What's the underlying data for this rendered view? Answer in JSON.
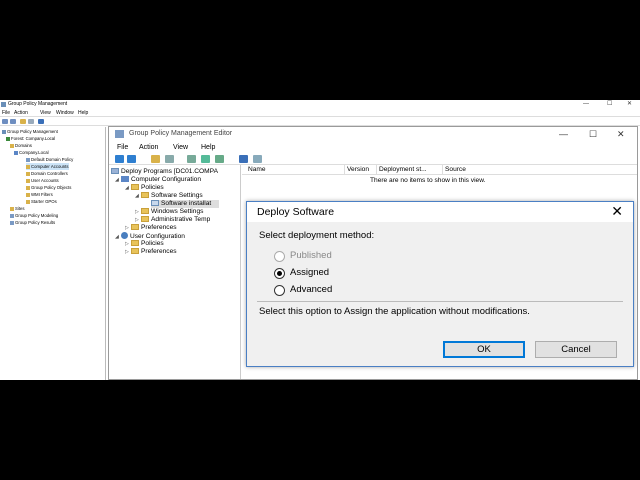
{
  "outer": {
    "title": "Group Policy Management",
    "menu": [
      "File",
      "Action",
      "View",
      "Window",
      "Help"
    ],
    "tree": [
      {
        "label": "Group Policy Management",
        "indent": 0
      },
      {
        "label": "Forest: Company.Local",
        "indent": 1
      },
      {
        "label": "Domains",
        "indent": 2
      },
      {
        "label": "Company.Local",
        "indent": 3
      },
      {
        "label": "Default Domain Policy",
        "indent": 4
      },
      {
        "label": "Computer Accounts",
        "indent": 4
      },
      {
        "label": "Domain Controllers",
        "indent": 4
      },
      {
        "label": "User Accounts",
        "indent": 4
      },
      {
        "label": "Group Policy Objects",
        "indent": 4
      },
      {
        "label": "WMI Filters",
        "indent": 4
      },
      {
        "label": "Starter GPOs",
        "indent": 4
      },
      {
        "label": "Sites",
        "indent": 2
      },
      {
        "label": "Group Policy Modeling",
        "indent": 2
      },
      {
        "label": "Group Policy Results",
        "indent": 2
      }
    ]
  },
  "inner": {
    "title": "Group Policy Management Editor",
    "menu": [
      "File",
      "Action",
      "View",
      "Help"
    ],
    "tree": [
      {
        "label": "Deploy Programs [DC01.COMPA",
        "indent": 0
      },
      {
        "label": "Computer Configuration",
        "indent": 1
      },
      {
        "label": "Policies",
        "indent": 2
      },
      {
        "label": "Software Settings",
        "indent": 3
      },
      {
        "label": "Software installat",
        "indent": 4
      },
      {
        "label": "Windows Settings",
        "indent": 3
      },
      {
        "label": "Administrative Temp",
        "indent": 3
      },
      {
        "label": "Preferences",
        "indent": 2
      },
      {
        "label": "User Configuration",
        "indent": 1
      },
      {
        "label": "Policies",
        "indent": 2
      },
      {
        "label": "Preferences",
        "indent": 2
      }
    ],
    "columns": [
      "Name",
      "Version",
      "Deployment st...",
      "Source"
    ],
    "empty_message": "There are no items to show in this view."
  },
  "dialog": {
    "title": "Deploy Software",
    "close_glyph": "✕",
    "prompt": "Select deployment method:",
    "options": [
      {
        "label": "Published",
        "selected": false,
        "enabled": false
      },
      {
        "label": "Assigned",
        "selected": true,
        "enabled": true
      },
      {
        "label": "Advanced",
        "selected": false,
        "enabled": true
      }
    ],
    "description": "Select this option to Assign the application without modifications.",
    "ok_label": "OK",
    "cancel_label": "Cancel"
  }
}
